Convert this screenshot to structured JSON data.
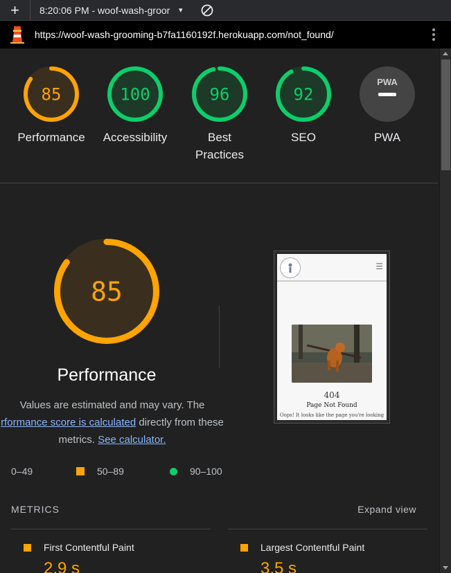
{
  "toolbar": {
    "plus": "+",
    "session": "8:20:06 PM - woof-wash-groor",
    "caret": "▾"
  },
  "urlbar": {
    "url": "https://woof-wash-grooming-b7fa1160192f.herokuapp.com/not_found/"
  },
  "colors": {
    "average": "#ffa400",
    "pass": "#0cce6b",
    "fail": "#ff4e42",
    "link": "#8ab4f8"
  },
  "gauges": [
    {
      "score": "85",
      "label": "Performance",
      "fraction": 0.85,
      "rating": "average"
    },
    {
      "score": "100",
      "label": "Accessibility",
      "fraction": 1.0,
      "rating": "pass"
    },
    {
      "score": "96",
      "label": "Best Practices",
      "fraction": 0.96,
      "rating": "pass"
    },
    {
      "score": "92",
      "label": "SEO",
      "fraction": 0.92,
      "rating": "pass"
    },
    {
      "score": "PWA",
      "label": "PWA",
      "rating": "na"
    }
  ],
  "performance": {
    "score": "85",
    "fraction": 0.85,
    "title": "Performance",
    "desc_1": "Values are estimated and may vary. The",
    "desc_link_1": "rformance score is calculated",
    "desc_2": " directly from these",
    "desc_3": "metrics. ",
    "desc_link_2": "See calculator."
  },
  "legend": {
    "fail": "0–49",
    "average": "50–89",
    "pass": "90–100"
  },
  "thumbnail": {
    "code": "404",
    "heading": "Page Not Found",
    "message": "Oops! It looks like the page you're looking"
  },
  "metrics": {
    "heading": "METRICS",
    "expand": "Expand view",
    "items": [
      {
        "name": "First Contentful Paint",
        "value": "2.9 s"
      },
      {
        "name": "Largest Contentful Paint",
        "value": "3.5 s"
      }
    ]
  }
}
